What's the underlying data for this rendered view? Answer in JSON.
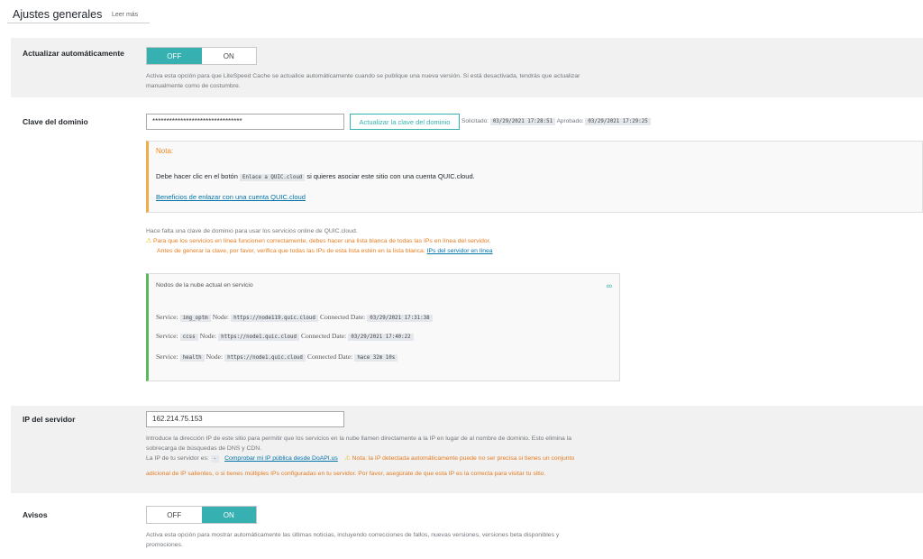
{
  "header": {
    "title": "Ajustes generales",
    "read_more": "Leer más"
  },
  "auto_update": {
    "label": "Actualizar automáticamente",
    "off": "OFF",
    "on": "ON",
    "selected": "OFF",
    "desc_line1": "Activa esta opción para que LiteSpeed Cache se actualice automáticamente cuando se publique una nueva versión. Si está desactivada, tendrás que actualizar",
    "desc_line2": "manualmente como de costumbre."
  },
  "domain_key": {
    "label": "Clave del dominio",
    "value": "********************************",
    "button": "Actualizar la clave del dominio",
    "requested_label": "Solicitado:",
    "requested_value": "03/29/2021 17:28:51",
    "approved_label": "Aprobado:",
    "approved_value": "03/29/2021 17:29:25",
    "note": {
      "title": "Nota:",
      "text_before": "Debe hacer clic en el botón",
      "code": "Enlace a QUIC.cloud",
      "text_after": "si quieres asociar este sitio con una cuenta QUIC.cloud.",
      "link": "Beneficios de enlazar con una cuenta QUIC.cloud"
    },
    "desc": "Hace falta una clave de dominio para usar los servicios online de QUIC.cloud.",
    "warning_line1": "Para que los servicios en línea funcionen correctamente, debes hacer una lista blanca de todas las IPs en línea del servidor.",
    "warning_line2": "Antes de generar la clave, por favor, verifica que todas las IPs de esta lista estén en la lista blanca:",
    "warning_link": "IPs del servidor en línea",
    "nodes": {
      "title": "Nodos de la nube actual en servicio",
      "service_label": "Service:",
      "node_label": "Node:",
      "date_label": "Connected Date:",
      "rows": [
        {
          "service": "img_optm",
          "node": "https://node119.quic.cloud",
          "date": "03/29/2021 17:31:38"
        },
        {
          "service": "ccss",
          "node": "https://node1.quic.cloud",
          "date": "03/29/2021 17:40:22"
        },
        {
          "service": "health",
          "node": "https://node1.quic.cloud",
          "date": "hace 32m 10s"
        }
      ]
    }
  },
  "server_ip": {
    "label": "IP del servidor",
    "value": "162.214.75.153",
    "desc_line1": "Introduce la dirección IP de este sitio para permitir que los servicios en la nube llamen directamente a la IP en lugar de al nombre de dominio. Esto elimina la",
    "desc_line2": "sobrecarga de búsquedas de DNS y CDN.",
    "your_ip": "La IP de tu servidor es:",
    "your_ip_value": "-",
    "check_link": "Comprobar mi IP pública desde DoAPI.us",
    "note_line1": "Nota: la IP detectada automáticamente puede no ser precisa si tienes un conjunto",
    "note_line2": "adicional de IP salientes, o si tienes múltiples IPs configuradas en tu servidor. Por favor, asegúrate de que esta IP es la correcta para visitar tu sitio."
  },
  "notices": {
    "label": "Avisos",
    "off": "OFF",
    "on": "ON",
    "selected": "ON",
    "desc_line1": "Activa esta opción para mostrar automáticamente las últimas noticias, incluyendo correcciones de fallos, nuevas versiones, versiones beta disponibles y",
    "desc_line2": "promociones."
  },
  "colors": {
    "accent": "#36b0b0",
    "warning": "#e57c20",
    "note_border": "#f0ad4e",
    "nodes_border": "#5cb85c"
  }
}
